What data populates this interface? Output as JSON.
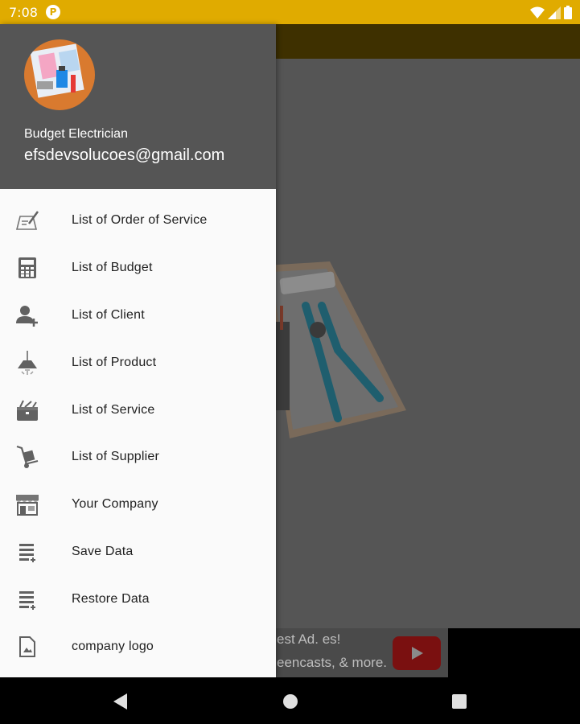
{
  "status_bar": {
    "time": "7:08",
    "notification_icon": "p-icon",
    "icons": [
      "wifi-icon",
      "signal-icon",
      "battery-icon"
    ]
  },
  "drawer": {
    "header": {
      "avatar_icon": "avatar-logo",
      "name": "Budget Electrician",
      "email": "efsdevsolucoes@gmail.com"
    },
    "items": [
      {
        "label": "List of Order of Service",
        "icon": "clipboard-pen-icon"
      },
      {
        "label": "List of Budget",
        "icon": "calculator-icon"
      },
      {
        "label": "List of Client",
        "icon": "add-user-icon"
      },
      {
        "label": "List of Product",
        "icon": "lamp-icon"
      },
      {
        "label": "List of Service",
        "icon": "toolbox-icon"
      },
      {
        "label": "List of Supplier",
        "icon": "hand-truck-icon"
      },
      {
        "label": "Your Company",
        "icon": "storefront-icon"
      },
      {
        "label": "Save Data",
        "icon": "playlist-add-icon"
      },
      {
        "label": "Restore Data",
        "icon": "playlist-restore-icon"
      },
      {
        "label": "company logo",
        "icon": "image-file-icon"
      }
    ]
  },
  "ad_banner": {
    "line1": "est Ad. es!",
    "line2": "eencasts, & more."
  },
  "colors": {
    "status_bar": "#e0ab00",
    "drawer_header": "#555555",
    "drawer_background": "#fafafa",
    "icon_gray": "#616161"
  }
}
